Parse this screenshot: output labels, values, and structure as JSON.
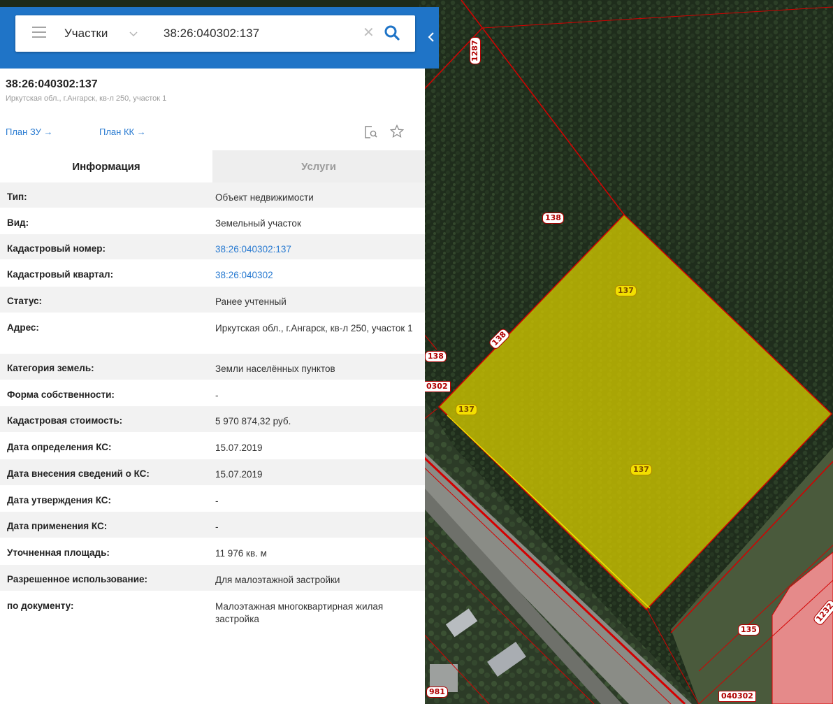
{
  "search": {
    "layer_label": "Участки",
    "query": "38:26:040302:137"
  },
  "object": {
    "cadastral_number": "38:26:040302:137",
    "address": "Иркутская обл., г.Ангарск, кв-л 250, участок 1",
    "link_plan_zu": "План ЗУ →",
    "link_plan_kk": "План КК →"
  },
  "tabs": {
    "info": "Информация",
    "services": "Услуги"
  },
  "info_rows": [
    {
      "label": "Тип:",
      "value": "Объект недвижимости",
      "link": false
    },
    {
      "label": "Вид:",
      "value": "Земельный участок",
      "link": false
    },
    {
      "label": "Кадастровый номер:",
      "value": "38:26:040302:137",
      "link": true
    },
    {
      "label": "Кадастровый квартал:",
      "value": "38:26:040302",
      "link": true
    },
    {
      "label": "Статус:",
      "value": "Ранее учтенный",
      "link": false
    },
    {
      "label": "Адрес:",
      "value": "Иркутская обл., г.Ангарск, кв-л 250, участок 1",
      "link": false
    },
    {
      "label": "Категория земель:",
      "value": "Земли населённых пунктов",
      "link": false
    },
    {
      "label": "Форма собственности:",
      "value": "-",
      "link": false
    },
    {
      "label": "Кадастровая стоимость:",
      "value": "5 970 874,32 руб.",
      "link": false
    },
    {
      "label": "Дата определения КС:",
      "value": "15.07.2019",
      "link": false
    },
    {
      "label": "Дата внесения сведений о КС:",
      "value": "15.07.2019",
      "link": false
    },
    {
      "label": "Дата утверждения КС:",
      "value": "-",
      "link": false
    },
    {
      "label": "Дата применения КС:",
      "value": "-",
      "link": false
    },
    {
      "label": "Уточненная площадь:",
      "value": "11 976 кв. м",
      "link": false
    },
    {
      "label": "Разрешенное использование:",
      "value": "Для малоэтажной застройки",
      "link": false
    },
    {
      "label": "по документу:",
      "value": "Малоэтажная многоквартирная жилая застройка",
      "link": false
    }
  ],
  "map": {
    "labels": {
      "l1287": "1287",
      "l138a": "138",
      "l137a": "137",
      "l138b": "138",
      "l138c": "138",
      "l0302": "0302",
      "l137b": "137",
      "l137c": "137",
      "l135": "135",
      "l1232": "1232",
      "l981": "981",
      "l040302": "040302"
    },
    "colors": {
      "accent": "#1f74c7",
      "parcel_fill": "#c8c000",
      "boundary": "#d40000",
      "building": "#e58a8a"
    }
  }
}
